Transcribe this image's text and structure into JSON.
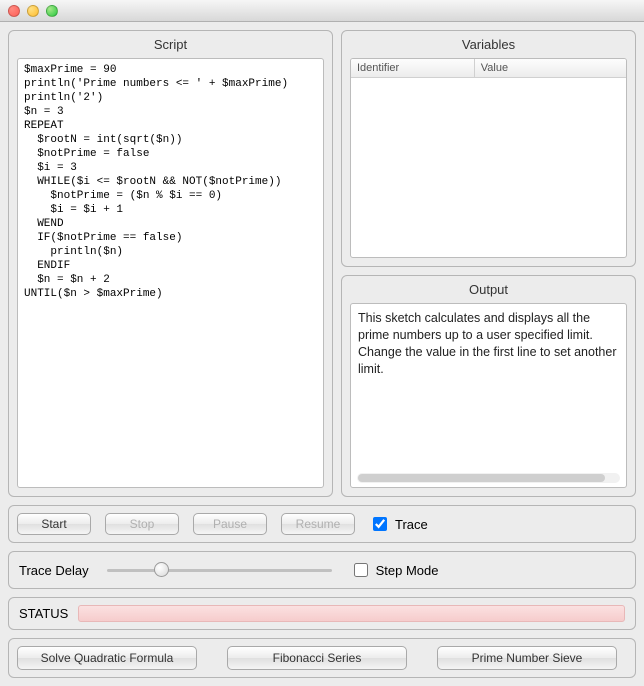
{
  "window": {
    "title": ""
  },
  "script": {
    "panel_title": "Script",
    "code": "$maxPrime = 90\nprintln('Prime numbers <= ' + $maxPrime)\nprintln('2')\n$n = 3\nREPEAT\n  $rootN = int(sqrt($n))\n  $notPrime = false\n  $i = 3\n  WHILE($i <= $rootN && NOT($notPrime))\n    $notPrime = ($n % $i == 0)\n    $i = $i + 1\n  WEND\n  IF($notPrime == false)\n    println($n)\n  ENDIF\n  $n = $n + 2\nUNTIL($n > $maxPrime)"
  },
  "variables": {
    "panel_title": "Variables",
    "columns": {
      "identifier": "Identifier",
      "value": "Value"
    },
    "rows": []
  },
  "output": {
    "panel_title": "Output",
    "text": "This sketch calculates and displays all the prime numbers up to a user specified limit. Change the value in the first line to set another limit."
  },
  "controls": {
    "start": "Start",
    "stop": "Stop",
    "pause": "Pause",
    "resume": "Resume",
    "trace_label": "Trace",
    "trace_checked": true
  },
  "trace_delay": {
    "label": "Trace Delay",
    "step_mode_label": "Step Mode",
    "step_mode_checked": false
  },
  "status": {
    "label": "STATUS",
    "color": "#f6cccc"
  },
  "examples": {
    "quadratic": "Solve Quadratic Formula",
    "fibonacci": "Fibonacci Series",
    "primes": "Prime Number Sieve"
  }
}
